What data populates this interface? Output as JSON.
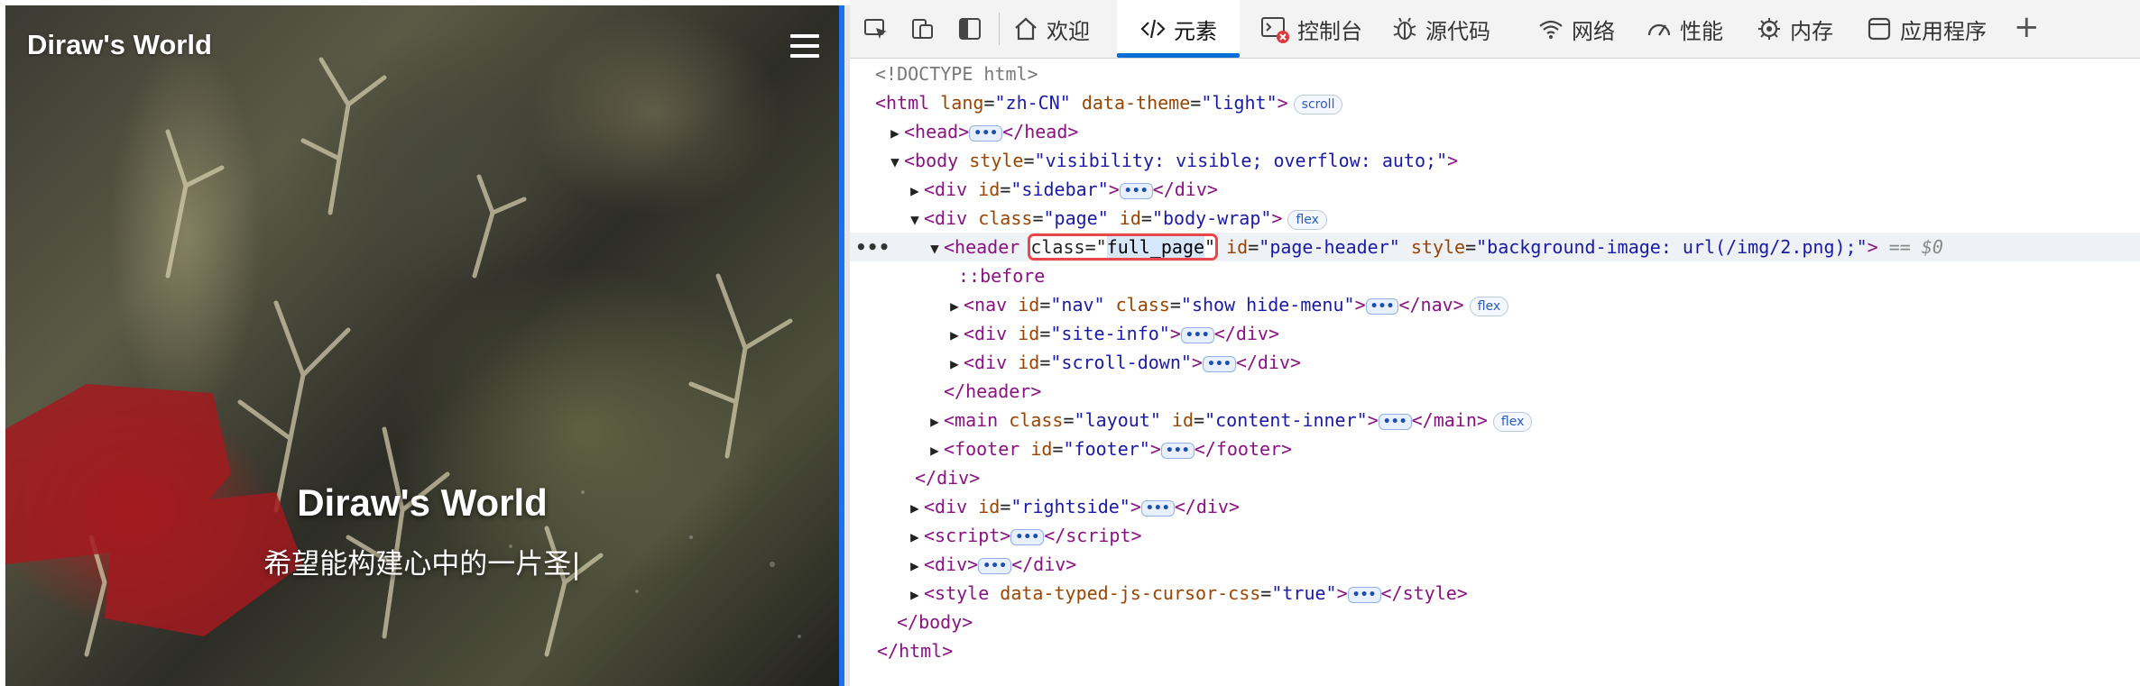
{
  "page": {
    "site_title": "Diraw's World",
    "hero_title": "Diraw's World",
    "hero_subtitle": "希望能构建心中的一片圣|"
  },
  "devtools": {
    "tabs": [
      {
        "label": "欢迎",
        "icon": "home-icon"
      },
      {
        "label": "元素",
        "icon": "code-icon",
        "active": true
      },
      {
        "label": "控制台",
        "icon": "console-icon"
      },
      {
        "label": "源代码",
        "icon": "bug-icon"
      },
      {
        "label": "网络",
        "icon": "wifi-icon"
      },
      {
        "label": "性能",
        "icon": "gauge-icon"
      },
      {
        "label": "内存",
        "icon": "memory-chip-icon"
      },
      {
        "label": "应用程序",
        "icon": "app-window-icon"
      }
    ],
    "add_tab_label": "+",
    "dom": {
      "doctype": "<!DOCTYPE html>",
      "html_lang": "zh-CN",
      "html_theme": "light",
      "html_badge": "scroll",
      "body_style": "visibility: visible; overflow: auto;",
      "sidebar_id": "sidebar",
      "page_class": "page",
      "page_id": "body-wrap",
      "flex_badge": "flex",
      "header_class": "full_page",
      "header_id": "page-header",
      "header_style": "background-image: url(/img/2.png);",
      "eq_ref": "== $0",
      "before": "::before",
      "nav_id": "nav",
      "nav_class": "show hide-menu",
      "site_info_id": "site-info",
      "scroll_down_id": "scroll-down",
      "main_class": "layout",
      "main_id": "content-inner",
      "footer_id": "footer",
      "rightside_id": "rightside",
      "style_attr": "data-typed-js-cursor-css",
      "style_attr_val": "true",
      "ellipsis": "•••",
      "row_dots": "•••"
    }
  },
  "colors": {
    "tab_underline": "#0b6dd6",
    "highlight_box": "#e8474c",
    "tag": "#881280",
    "attr_name": "#994500",
    "attr_value": "#1a1aa6"
  }
}
